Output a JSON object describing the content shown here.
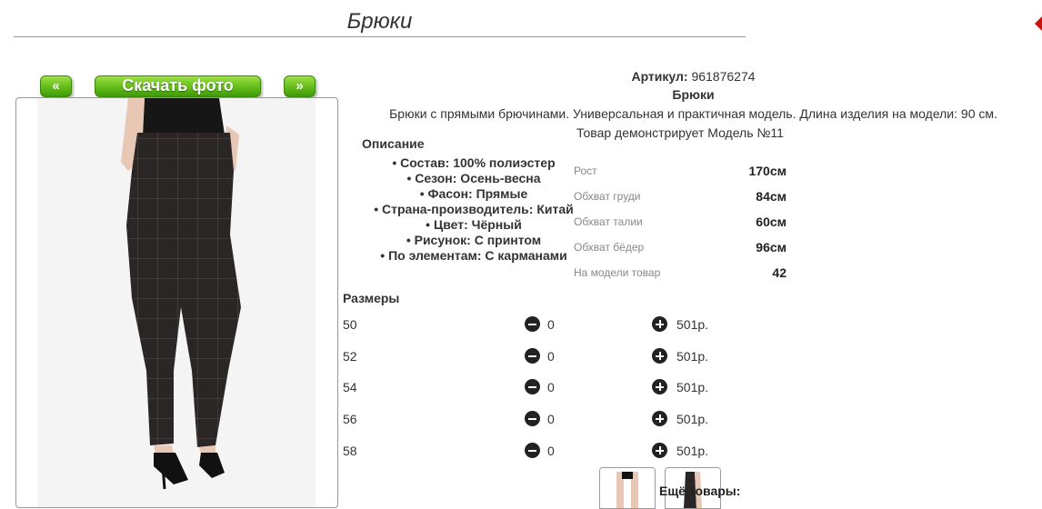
{
  "page": {
    "title": "Брюки"
  },
  "photo_nav": {
    "prev_label": "«",
    "download_label": "Скачать фото",
    "next_label": "»"
  },
  "product": {
    "article_label": "Артикул:",
    "article_value": "961876274",
    "name": "Брюки",
    "description": "Брюки с прямыми брючинами. Универсальная и практичная модель. Длина изделия на модели: 90 см.",
    "model_caption": "Товар демонстрирует Модель №11"
  },
  "description_section": {
    "heading": "Описание",
    "items": [
      "Состав: 100% полиэстер",
      "Сезон: Осень-весна",
      "Фасон: Прямые",
      "Страна-производитель: Китай",
      "Цвет: Чёрный",
      "Рисунок: С принтом",
      "По элементам: С карманами"
    ]
  },
  "model_measurements": [
    {
      "label": "Рост",
      "value": "170см"
    },
    {
      "label": "Обхват груди",
      "value": "84см"
    },
    {
      "label": "Обхват талии",
      "value": "60см"
    },
    {
      "label": "Обхват бёдер",
      "value": "96см"
    },
    {
      "label": "На модели товар",
      "value": "42"
    }
  ],
  "sizes_section": {
    "heading": "Размеры",
    "rows": [
      {
        "size": "50",
        "quantity": "0",
        "price": "501р."
      },
      {
        "size": "52",
        "quantity": "0",
        "price": "501р."
      },
      {
        "size": "54",
        "quantity": "0",
        "price": "501р."
      },
      {
        "size": "56",
        "quantity": "0",
        "price": "501р."
      },
      {
        "size": "58",
        "quantity": "0",
        "price": "501р."
      }
    ]
  },
  "more_products": {
    "heading": "Ещё товары:"
  },
  "icons": {
    "minus": "minus-circle-icon",
    "plus": "plus-circle-icon"
  },
  "colors": {
    "button_green": "#6cc21e",
    "icon_dark": "#222222",
    "deco_red": "#cc1111"
  }
}
